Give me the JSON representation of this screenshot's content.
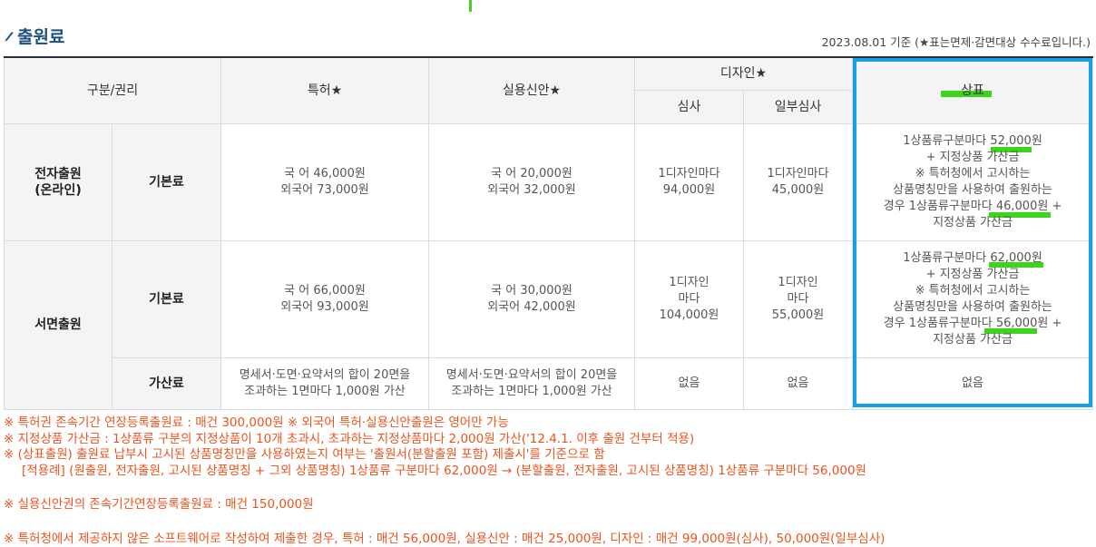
{
  "page": {
    "title": "출원료",
    "basis": "2023.08.01 기준 (★표는면제·감면대상 수수료입니다.)"
  },
  "table": {
    "headers": {
      "category": "구분/권리",
      "patent": "특허★",
      "utility": "실용신안★",
      "design": "디자인★",
      "design_exam": "심사",
      "design_partial": "일부심사",
      "trademark": "상표"
    },
    "rows": [
      {
        "group": "전자출원\n(온라인)",
        "type": "기본료",
        "patent": "국 어 46,000원\n외국어 73,000원",
        "utility": "국 어 20,000원\n외국어 32,000원",
        "design_exam": "1디자인마다\n94,000원",
        "design_partial": "1디자인마다\n45,000원",
        "trademark": "1상품류구분마다 52,000원\n+ 지정상품 가산금\n※ 특허청에서 고시하는\n상품명칭만을 사용하여 출원하는\n경우 1상품류구분마다 46,000원 +\n지정상품 가산금"
      },
      {
        "group": "서면출원",
        "type": "기본료",
        "patent": "국 어 66,000원\n외국어 93,000원",
        "utility": "국 어 30,000원\n외국어 42,000원",
        "design_exam": "1디자인\n마다\n104,000원",
        "design_partial": "1디자인\n마다\n55,000원",
        "trademark": "1상품류구분마다 62,000원\n+ 지정상품 가산금\n※ 특허청에서 고시하는\n상품명칭만을 사용하여 출원하는\n경우 1상품류구분마다 56,000원 +\n지정상품 가산금"
      },
      {
        "type": "가산료",
        "patent": "명세서·도면·요약서의 합이 20면을\n조과하는 1면마다 1,000원 가산",
        "utility": "명세서·도면·요약서의 합이 20면을\n조과하는 1면마다 1,000원 가산",
        "design_exam": "없음",
        "design_partial": "없음",
        "trademark": "없음"
      }
    ]
  },
  "notes": [
    "※ 특허권 존속기간 연장등록출원료 : 매건 300,000원 ※ 외국어 특허·실용신안출원은 영어만 가능",
    "※ 지정상품 가산금 : 1상품류 구분의 지정상품이 10개 초과시, 초과하는 지정상품마다 2,000원 가산('12.4.1. 이후 출원 건부터 적용)",
    "※ (상표출원) 출원료 납부시 고시된 상품명칭만을 사용하였는지 여부는 '출원서(분할출원 포함) 제출시'를 기준으로 함",
    "[적용례] (원출원, 전자출원, 고시된 상품명칭 + 그외 상품명칭) 1상품류 구분마다 62,000원 → (분할출원, 전자출원, 고시된 상품명칭) 1상품류 구분마다 56,000원",
    "※ 실용신안권의 존속기간연장등록출원료 : 매건 150,000원",
    "※ 특허청에서 제공하지 않은 소프트웨어로 작성하여 제출한 경우, 특허 : 매건 56,000원, 실용신안 : 매건 25,000원, 디자인 : 매건 99,000원(심사), 50,000원(일부심사)"
  ],
  "colors": {
    "title": "#1d4f7c",
    "notes": "#e8541d",
    "highlight_box": "#16a0e8",
    "marker": "#3ed31c"
  },
  "icons": {
    "title_icon": "pencil-icon"
  }
}
